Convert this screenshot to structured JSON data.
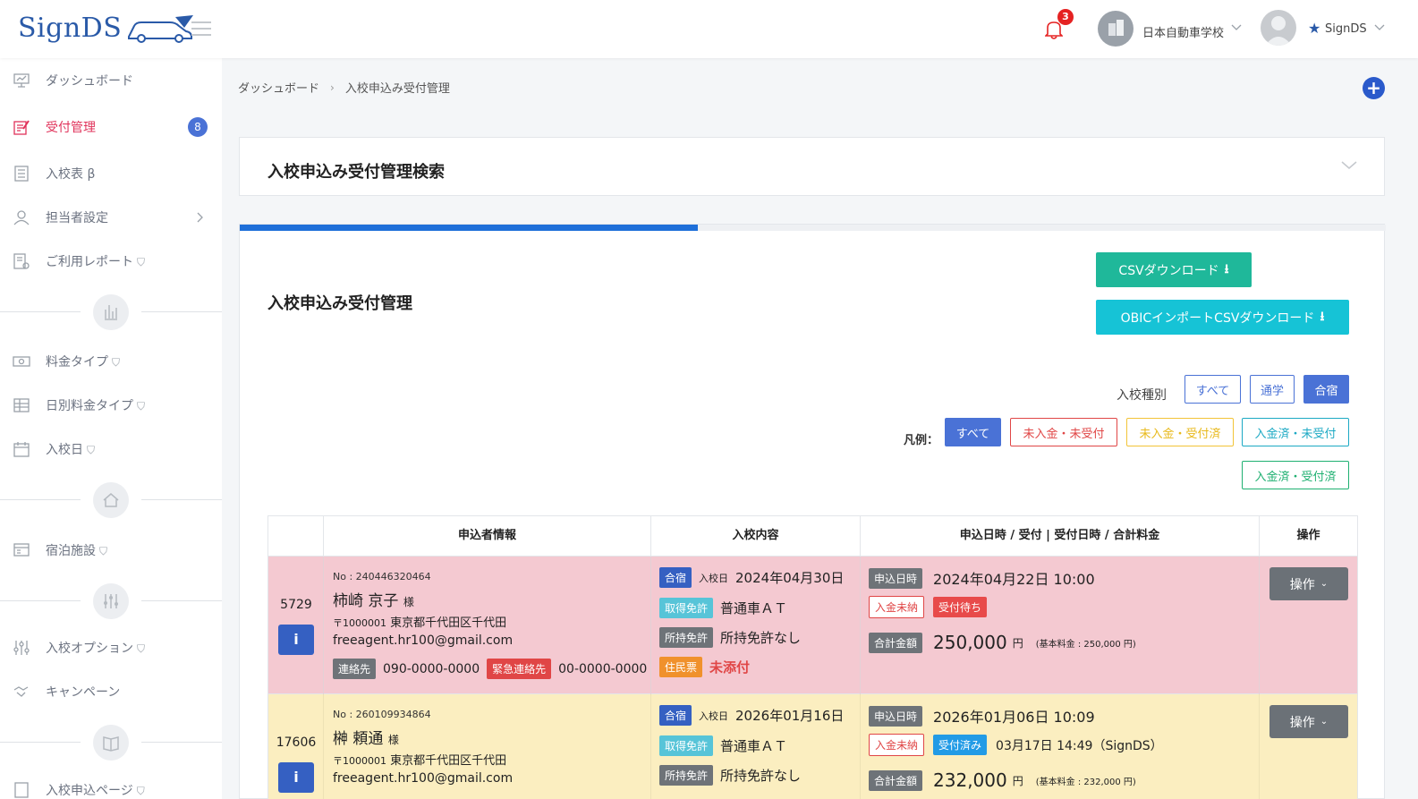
{
  "header": {
    "logo": "SignDS",
    "notification_count": "3",
    "school_name": "日本自動車学校",
    "user_name": "SignDS"
  },
  "sidebar": {
    "items": [
      {
        "label": "ダッシュボード"
      },
      {
        "label": "受付管理",
        "badge": "8"
      },
      {
        "label": "入校表 β"
      },
      {
        "label": "担当者設定"
      },
      {
        "label": "ご利用レポート"
      },
      {
        "label": "料金タイプ"
      },
      {
        "label": "日別料金タイプ"
      },
      {
        "label": "入校日"
      },
      {
        "label": "宿泊施設"
      },
      {
        "label": "入校オプション"
      },
      {
        "label": "キャンペーン"
      },
      {
        "label": "入校申込ページ"
      }
    ]
  },
  "breadcrumb": {
    "home": "ダッシュボード",
    "current": "入校申込み受付管理"
  },
  "search_card": {
    "title": "入校申込み受付管理検索"
  },
  "main": {
    "progress_fraction": 0.4,
    "title": "入校申込み受付管理",
    "csv_button": "CSVダウンロード",
    "obic_button": "OBICインポートCSVダウンロード",
    "type_label": "入校種別",
    "type_filters": [
      "すべて",
      "通学",
      "合宿"
    ],
    "legend_label": "凡例：",
    "legend_filters": [
      "すべて",
      "未入金・未受付",
      "未入金・受付済",
      "入金済・未受付",
      "入金済・受付済"
    ]
  },
  "table": {
    "headers": [
      "申込者情報",
      "入校内容",
      "申込日時 / 受付 | 受付日時 / 合計料金",
      "操作"
    ],
    "rows": [
      {
        "id": "5729",
        "no": "No : 240446320464",
        "name": "柿崎 京子",
        "honorific": "様",
        "zip": "〒1000001",
        "address": "東京都千代田区千代田",
        "email": "freeagent.hr100@gmail.com",
        "contact_label": "連絡先",
        "contact": "090-0000-0000",
        "emergency_label": "緊急連絡先",
        "emergency": "00-0000-0000",
        "course_tag": "合宿",
        "entry_label": "入校日",
        "entry_date": "2024年04月30日",
        "license_label": "取得免許",
        "license": "普通車ＡＴ",
        "held_label": "所持免許",
        "held": "所持免許なし",
        "resident_label": "住民票",
        "resident": "未添付",
        "apply_label": "申込日時",
        "apply_date": "2024年04月22日 10:00",
        "payment_status": "入金未納",
        "reception_status": "受付待ち",
        "reception_time": "",
        "total_label": "合計金額",
        "total": "250,000",
        "yen": "円",
        "base_fee": "(基本料金 : 250,000 円)",
        "op": "操作"
      },
      {
        "id": "17606",
        "no": "No : 260109934864",
        "name": "榊 頼通",
        "honorific": "様",
        "zip": "〒1000001",
        "address": "東京都千代田区千代田",
        "email": "freeagent.hr100@gmail.com",
        "course_tag": "合宿",
        "entry_label": "入校日",
        "entry_date": "2026年01月16日",
        "license_label": "取得免許",
        "license": "普通車ＡＴ",
        "held_label": "所持免許",
        "held": "所持免許なし",
        "apply_label": "申込日時",
        "apply_date": "2026年01月06日 10:09",
        "payment_status": "入金未納",
        "reception_status": "受付済み",
        "reception_time": "03月17日 14:49（SignDS）",
        "total_label": "合計金額",
        "total": "232,000",
        "yen": "円",
        "base_fee": "(基本料金 : 232,000 円)",
        "op": "操作"
      }
    ]
  },
  "colors": {
    "brand": "#2a5aa8",
    "active_menu": "#e0335b",
    "pink_row": "#f4c9d1",
    "yellow_row": "#fbeec0",
    "csv_button": "#1fb89a",
    "obic_button": "#16c3d6"
  }
}
